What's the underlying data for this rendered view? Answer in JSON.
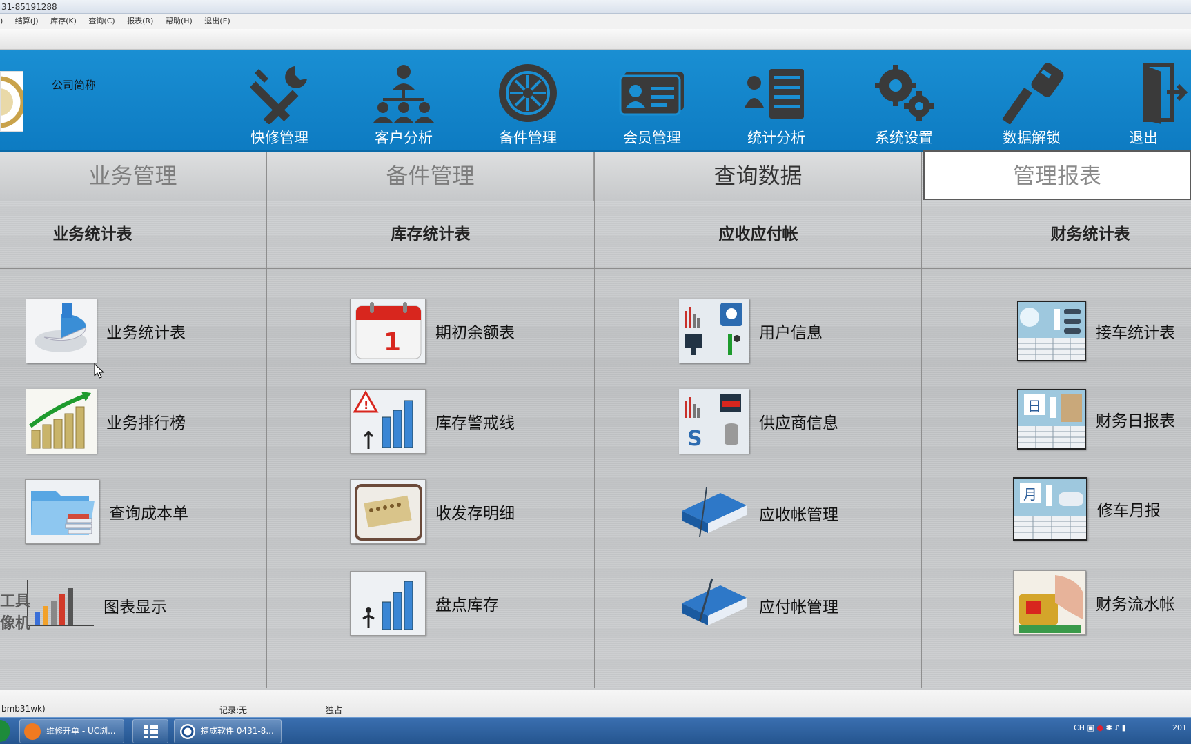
{
  "window": {
    "title_fragment": "31-85191288"
  },
  "menu": [
    ")",
    "结算(J)",
    "库存(K)",
    "查询(C)",
    "报表(R)",
    "帮助(H)",
    "退出(E)"
  ],
  "header": {
    "company": "公司简称",
    "nav": [
      {
        "label": "快修管理",
        "icon": "wrench-screwdriver-icon"
      },
      {
        "label": "客户分析",
        "icon": "org-chart-icon"
      },
      {
        "label": "备件管理",
        "icon": "wheel-icon"
      },
      {
        "label": "会员管理",
        "icon": "member-card-icon"
      },
      {
        "label": "统计分析",
        "icon": "list-stats-icon"
      },
      {
        "label": "系统设置",
        "icon": "gears-icon"
      },
      {
        "label": "数据解锁",
        "icon": "key-icon"
      },
      {
        "label": "退出",
        "icon": "exit-door-icon"
      }
    ]
  },
  "tabs": [
    {
      "label": "业务管理"
    },
    {
      "label": "备件管理"
    },
    {
      "label": "查询数据"
    },
    {
      "label": "管理报表"
    }
  ],
  "columns": [
    {
      "heading": "业务统计表",
      "items": [
        {
          "label": "业务统计表",
          "icon": "pie-chart-3d-icon"
        },
        {
          "label": "业务排行榜",
          "icon": "growth-bars-icon"
        },
        {
          "label": "查询成本单",
          "icon": "folder-documents-icon"
        },
        {
          "label": "图表显示",
          "icon": "bar-chart-icon"
        }
      ]
    },
    {
      "heading": "库存统计表",
      "items": [
        {
          "label": "期初余额表",
          "icon": "calendar-icon"
        },
        {
          "label": "库存警戒线",
          "icon": "warning-bars-icon"
        },
        {
          "label": "收发存明细",
          "icon": "abacus-icon"
        },
        {
          "label": "盘点库存",
          "icon": "stock-bars-icon"
        }
      ]
    },
    {
      "heading": "应收应付帐",
      "items": [
        {
          "label": "用户信息",
          "icon": "user-info-icon"
        },
        {
          "label": "供应商信息",
          "icon": "supplier-info-icon"
        },
        {
          "label": "应收帐管理",
          "icon": "blue-book-icon"
        },
        {
          "label": "应付帐管理",
          "icon": "blue-book-pen-icon"
        }
      ]
    },
    {
      "heading": "财务统计表",
      "items": [
        {
          "label": "接车统计表",
          "icon": "car-report-icon"
        },
        {
          "label": "财务日报表",
          "icon": "daily-report-icon"
        },
        {
          "label": "修车月报",
          "icon": "monthly-report-icon"
        },
        {
          "label": "财务流水帐",
          "icon": "card-payment-icon"
        }
      ]
    }
  ],
  "watermark": [
    "工具",
    "像机"
  ],
  "status": {
    "db": "bmb31wk)",
    "record": "记录:无",
    "mode": "独占"
  },
  "taskbar": {
    "items": [
      "维修开单 - UC浏...",
      "",
      "捷成软件 0431-8..."
    ],
    "tray_lang": "CH",
    "clock_fragment": "201"
  },
  "colors": {
    "banner": "#1a8fd3",
    "icon_dark": "#333333"
  }
}
